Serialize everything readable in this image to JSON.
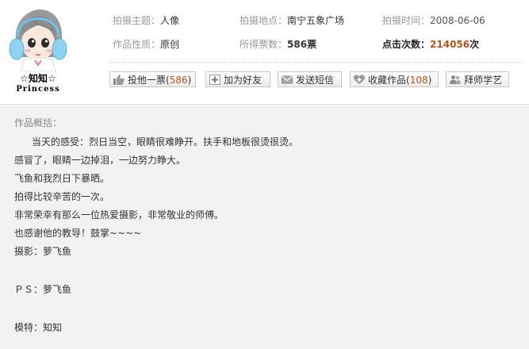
{
  "user": {
    "name": "☆知知☆",
    "subtitle": "Princess"
  },
  "info": {
    "theme_label": "拍摄主题：",
    "theme_value": "人像",
    "location_label": "拍摄地点：",
    "location_value": "南宁五象广场",
    "time_label": "拍摄时间：",
    "time_value": "2008-06-06",
    "nature_label": "作品性质：",
    "nature_value": "原创",
    "votes_label": "所得票数：",
    "votes_value": "586票",
    "clicks_label": "点击次数：",
    "clicks_value": "214056",
    "clicks_unit": "次"
  },
  "actions": {
    "vote_label": "投他一票",
    "vote_count": "586",
    "add_friend_label": "加为好友",
    "message_label": "发送短信",
    "favorite_label": "收藏作品",
    "favorite_count": "108",
    "apprentice_label": "拜师学艺"
  },
  "description": {
    "title": "作品概括：",
    "lines": [
      "当天的感受：烈日当空，眼睛很难睁开。扶手和地板很烫很烫。",
      "感冒了，眼睛一边掉泪，一边努力睁大。",
      "飞鱼和我烈日下暴晒。",
      "拍得比较辛苦的一次。",
      "非常荣幸有那么一位热爱摄影，非常敬业的师傅。",
      "也感谢他的教导！鼓掌~~~~",
      "摄影：萝飞鱼",
      "ＰＳ：萝飞鱼",
      "模特：知知"
    ]
  },
  "colors": {
    "accent_orange": "#b5541b",
    "label_gray": "#999999",
    "panel_bg": "#f2f2f2",
    "headset_blue": "#8fd3f0"
  },
  "icons": {
    "vote": "thumbs-up-icon",
    "add_friend": "plus-icon",
    "message": "envelope-icon",
    "favorite": "heart-icon",
    "apprentice": "people-icon"
  }
}
